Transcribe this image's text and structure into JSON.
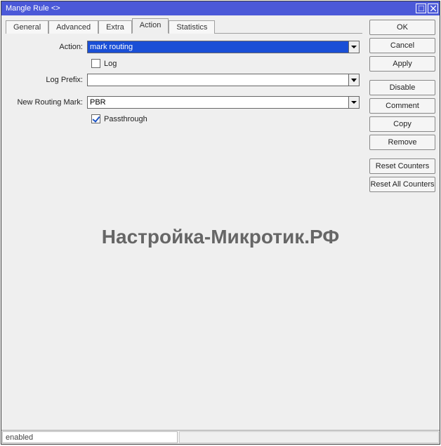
{
  "title": "Mangle Rule <>",
  "tabs": [
    "General",
    "Advanced",
    "Extra",
    "Action",
    "Statistics"
  ],
  "active_tab": 3,
  "form": {
    "action_label": "Action:",
    "action_value": "mark routing",
    "log_label": "Log",
    "log_checked": false,
    "log_prefix_label": "Log Prefix:",
    "log_prefix_value": "",
    "new_routing_mark_label": "New Routing Mark:",
    "new_routing_mark_value": "PBR",
    "passthrough_label": "Passthrough",
    "passthrough_checked": true
  },
  "buttons": {
    "ok": "OK",
    "cancel": "Cancel",
    "apply": "Apply",
    "disable": "Disable",
    "comment": "Comment",
    "copy": "Copy",
    "remove": "Remove",
    "reset_counters": "Reset Counters",
    "reset_all_counters": "Reset All Counters"
  },
  "status": "enabled",
  "watermark": "Настройка-Микротик.РФ"
}
